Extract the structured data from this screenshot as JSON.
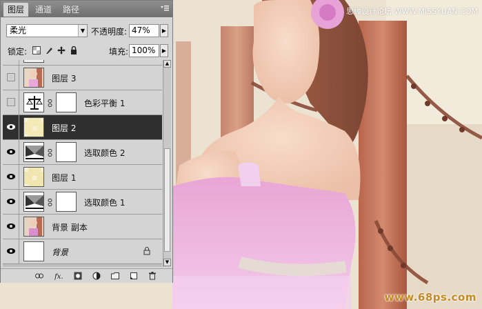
{
  "watermarks": {
    "top": "思缘设计论坛 WWW.MISSYUAN.COM",
    "bottom": "www.68ps.com"
  },
  "panel": {
    "tabs": [
      {
        "label": "图层",
        "active": true
      },
      {
        "label": "通道",
        "active": false
      },
      {
        "label": "路径",
        "active": false
      }
    ],
    "blend_mode": "柔光",
    "opacity_label": "不透明度:",
    "opacity_value": "47%",
    "lock_label": "锁定:",
    "fill_label": "填充:",
    "fill_value": "100%",
    "layers": [
      {
        "name": "图层 3",
        "visible": false,
        "selected": false,
        "thumb": "photo"
      },
      {
        "name": "色彩平衡 1",
        "visible": false,
        "selected": false,
        "thumb": "balance"
      },
      {
        "name": "图层 2",
        "visible": true,
        "selected": true,
        "thumb": "cream"
      },
      {
        "name": "选取颜色 2",
        "visible": true,
        "selected": false,
        "thumb": "selective"
      },
      {
        "name": "图层 1",
        "visible": true,
        "selected": false,
        "thumb": "cream"
      },
      {
        "name": "选取颜色 1",
        "visible": true,
        "selected": false,
        "thumb": "selective"
      },
      {
        "name": "背景 副本",
        "visible": true,
        "selected": false,
        "thumb": "photo"
      },
      {
        "name": "背景",
        "visible": true,
        "selected": false,
        "thumb": "white",
        "locked": true
      }
    ],
    "bottom_icons": [
      "link-icon",
      "fx-icon",
      "mask-icon",
      "adjustment-icon",
      "group-folder-icon",
      "new-layer-icon",
      "trash-icon"
    ]
  },
  "colors": {
    "panel_bg": "#d6d6d6",
    "selected_row": "#2f2f2f",
    "watermark_bottom": "#c58b22"
  }
}
